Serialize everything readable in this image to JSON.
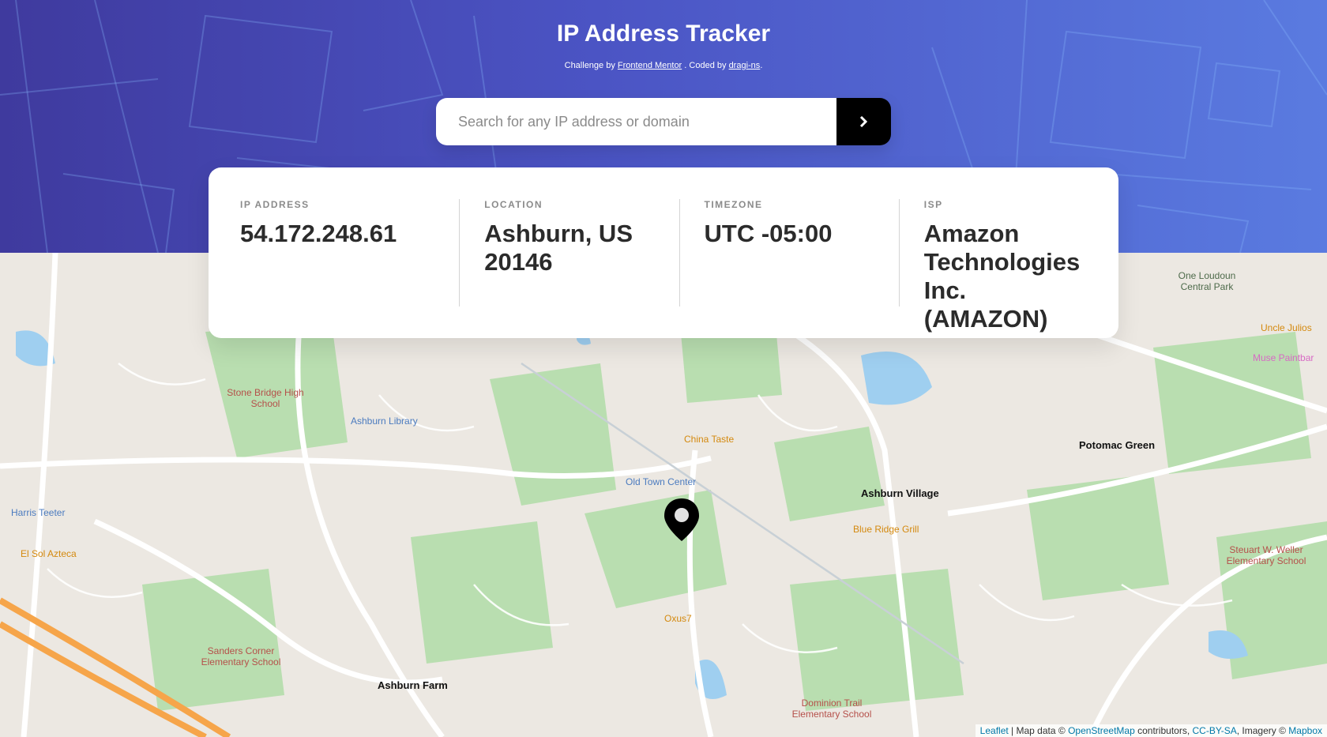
{
  "header": {
    "title": "IP Address Tracker",
    "credit_prefix": "Challenge by",
    "credit_frontend": "Frontend Mentor",
    "credit_middle": ". Coded by",
    "credit_author": "dragi-ns",
    "credit_suffix": "."
  },
  "search": {
    "placeholder": "Search for any IP address or domain",
    "button_icon": "chevron-right-icon"
  },
  "info": {
    "ip_label": "IP ADDRESS",
    "ip_value": "54.172.248.61",
    "location_label": "LOCATION",
    "location_value": "Ashburn, US 20146",
    "timezone_label": "TIMEZONE",
    "timezone_value": "UTC -05:00",
    "isp_label": "ISP",
    "isp_value": "Amazon Technologies Inc. (AMAZON)"
  },
  "map": {
    "marker_icon": "location-pin-icon",
    "towns": [
      "Ashburn Village",
      "Ashburn Farm",
      "Potomac Green"
    ],
    "places": [
      "Stone Bridge High School",
      "Ashburn Library",
      "China Taste",
      "Old Town Center",
      "Blue Ridge Grill",
      "Oxus7",
      "Sanders Corner Elementary School",
      "Dominion Trail Elementary School",
      "Steuart W. Weller Elementary School",
      "Harris Teeter",
      "El Sol Azteca",
      "One Loudoun Central Park",
      "Uncle Julios",
      "Muse Paintbar"
    ],
    "attribution": {
      "leaflet": "Leaflet",
      "mapdata": "| Map data ©",
      "osm": "OpenStreetMap",
      "contrib": "contributors,",
      "license": "CC-BY-SA",
      "imagery": ", Imagery ©",
      "mapbox": "Mapbox"
    }
  }
}
